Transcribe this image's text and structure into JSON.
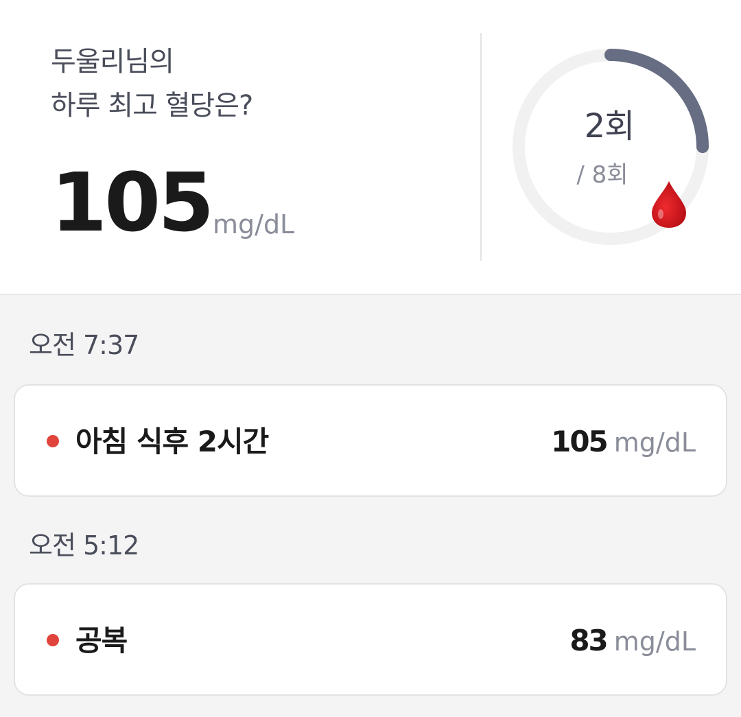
{
  "summary": {
    "greeting_line1": "두울리님의",
    "greeting_line2": "하루 최고 혈당은?",
    "max_value": "105",
    "unit": "mg/dL",
    "count_label": "2회",
    "total_label": "/ 8회",
    "measured_count": 2,
    "total_count": 8,
    "drop_icon": "blood-drop-icon",
    "colors": {
      "gauge_track": "#f1f1f2",
      "gauge_progress": "#676d82",
      "drop": "#d3131a",
      "dot": "#e0443c"
    }
  },
  "records": [
    {
      "time": "오전 7:37",
      "label": "아침 식후 2시간",
      "value": "105",
      "unit": "mg/dL"
    },
    {
      "time": "오전 5:12",
      "label": "공복",
      "value": "83",
      "unit": "mg/dL"
    }
  ]
}
